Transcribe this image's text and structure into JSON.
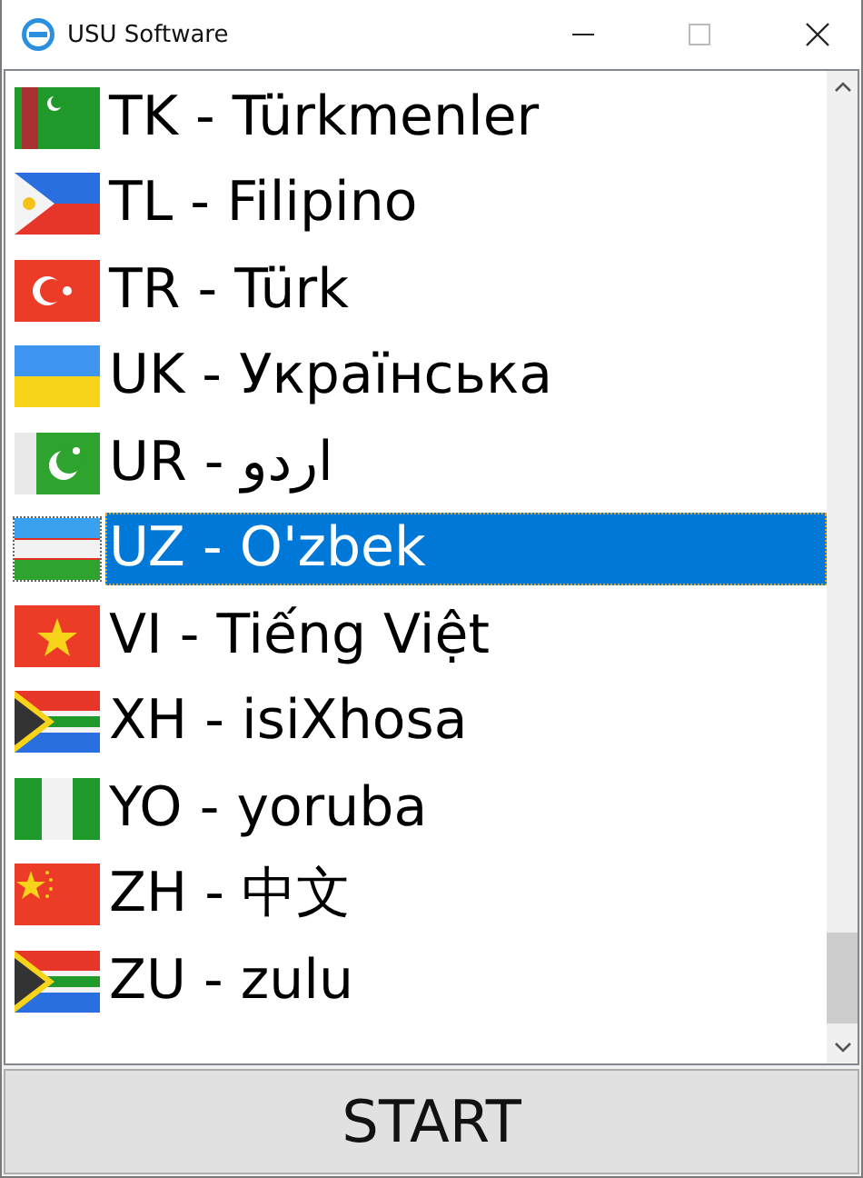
{
  "window": {
    "title": "USU Software"
  },
  "languages": [
    {
      "label": "TK - Türkmenler",
      "selected": false
    },
    {
      "label": "TL - Filipino",
      "selected": false
    },
    {
      "label": "TR - Türk",
      "selected": false
    },
    {
      "label": "UK - Українська",
      "selected": false
    },
    {
      "label": "UR - اردو",
      "selected": false
    },
    {
      "label": "UZ - O'zbek",
      "selected": true
    },
    {
      "label": "VI - Tiếng Việt",
      "selected": false
    },
    {
      "label": "XH - isiXhosa",
      "selected": false
    },
    {
      "label": "YO - yoruba",
      "selected": false
    },
    {
      "label": "ZH - 中文",
      "selected": false
    },
    {
      "label": "ZU - zulu",
      "selected": false
    }
  ],
  "start_button": "START"
}
